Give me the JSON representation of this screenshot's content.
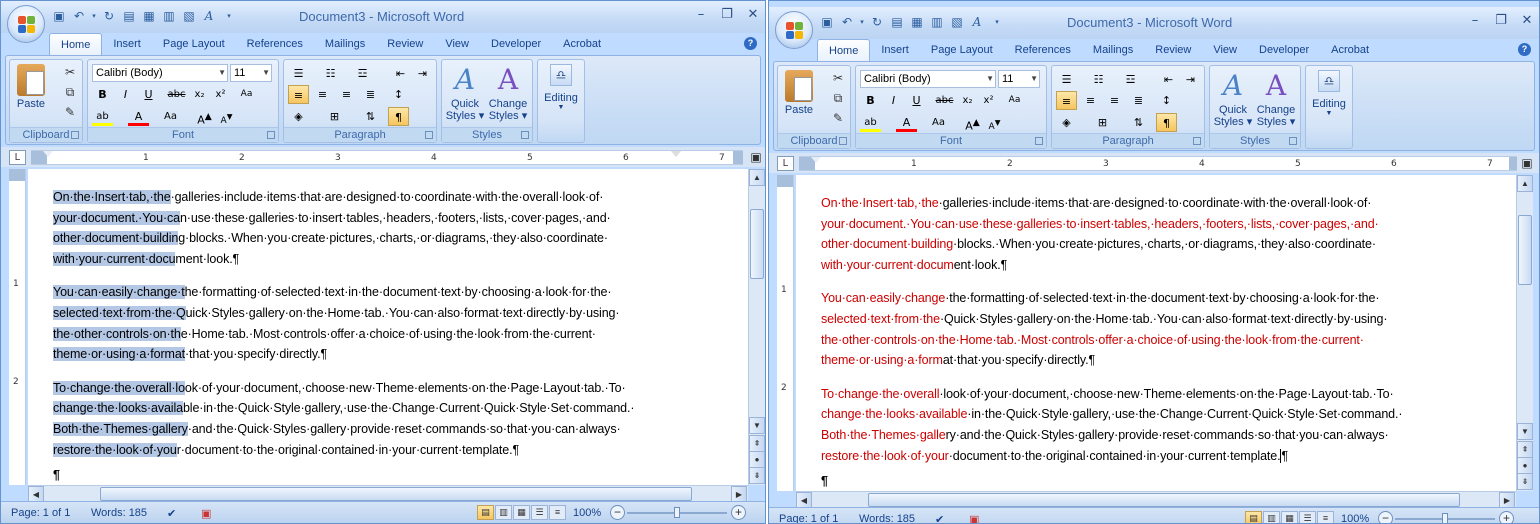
{
  "app": {
    "window_title": "Document3 - Microsoft Word",
    "tabs": [
      "Home",
      "Insert",
      "Page Layout",
      "References",
      "Mailings",
      "Review",
      "View",
      "Developer",
      "Acrobat"
    ]
  },
  "ribbon": {
    "clipboard": {
      "paste": "Paste",
      "label": "Clipboard"
    },
    "font": {
      "name": "Calibri (Body)",
      "size": "11",
      "label": "Font"
    },
    "paragraph": {
      "label": "Paragraph"
    },
    "styles": {
      "quick": "Quick",
      "quick2": "Styles ▾",
      "change": "Change",
      "change2": "Styles ▾",
      "label": "Styles"
    },
    "editing": {
      "label": "Editing"
    }
  },
  "ruler": {
    "numbers": [
      "1",
      "2",
      "3",
      "4",
      "5",
      "6",
      "7"
    ],
    "vnumbers": [
      "1",
      "2"
    ]
  },
  "document": {
    "paragraphs": [
      {
        "left": {
          "lines": [
            {
              "sel": "On·the·Insert·tab,·the",
              "rest": "·galleries·include·items·that·are·designed·to·coordinate·with·the·overall·look·of·"
            },
            {
              "sel": "your·document.·You·ca",
              "rest": "n·use·these·galleries·to·insert·tables,·headers,·footers,·lists,·cover·pages,·and·"
            },
            {
              "sel": "other·document·buildin",
              "rest": "g·blocks.·When·you·create·pictures,·charts,·or·diagrams,·they·also·coordinate·"
            },
            {
              "sel": "with·your·current·docu",
              "rest": "ment·look.¶"
            }
          ]
        },
        "right": {
          "lines": [
            {
              "red": "On·the·Insert·tab,·the",
              "rest": "·galleries·include·items·that·are·designed·to·coordinate·with·the·overall·look·of·"
            },
            {
              "red": "your·document.·You·can·use·these·galleries·to·insert·tables,·headers,·footers,·lists,·cover·pages,·and·",
              "rest": ""
            },
            {
              "red": "other·document·building",
              "rest": "·blocks.·When·you·create·pictures,·charts,·or·diagrams,·they·also·coordinate·"
            },
            {
              "red": "with·your·current·docum",
              "rest": "ent·look.¶"
            }
          ]
        }
      },
      {
        "left": {
          "lines": [
            {
              "sel": "You·can·easily·change·t",
              "rest": "he·formatting·of·selected·text·in·the·document·text·by·choosing·a·look·for·the·"
            },
            {
              "sel": "selected·text·from·the·Q",
              "rest": "uick·Styles·gallery·on·the·Home·tab.·You·can·also·format·text·directly·by·using·"
            },
            {
              "sel": "the·other·controls·on·th",
              "rest": "e·Home·tab.·Most·controls·offer·a·choice·of·using·the·look·from·the·current·"
            },
            {
              "sel": "theme·or·using·a·format",
              "rest": "·that·you·specify·directly.¶"
            }
          ]
        },
        "right": {
          "lines": [
            {
              "red": "You·can·easily·change",
              "rest": "·the·formatting·of·selected·text·in·the·document·text·by·choosing·a·look·for·the·"
            },
            {
              "red": "selected·text·from·the",
              "rest": "·Quick·Styles·gallery·on·the·Home·tab.·You·can·also·format·text·directly·by·using·"
            },
            {
              "red": "the·other·controls·on·the·Home·tab.·Most·controls·offer·a·choice·of·using·the·look·from·the·current·",
              "rest": ""
            },
            {
              "red": "theme·or·using·a·form",
              "rest": "at·that·you·specify·directly.¶"
            }
          ]
        }
      },
      {
        "left": {
          "lines": [
            {
              "sel": "To·change·the·overall·lo",
              "rest": "ok·of·your·document,·choose·new·Theme·elements·on·the·Page·Layout·tab.·To·"
            },
            {
              "sel": "change·the·looks·availa",
              "rest": "ble·in·the·Quick·Style·gallery,·use·the·Change·Current·Quick·Style·Set·command.·"
            },
            {
              "sel": "Both·the·Themes·gallery",
              "rest": "·and·the·Quick·Styles·gallery·provide·reset·commands·so·that·you·can·always·"
            },
            {
              "sel": "restore·the·look·of·you",
              "rest": "r·document·to·the·original·contained·in·your·current·template.¶"
            }
          ]
        },
        "right": {
          "lines": [
            {
              "red": "To·change·the·overall",
              "rest": "·look·of·your·document,·choose·new·Theme·elements·on·the·Page·Layout·tab.·To·"
            },
            {
              "red": "change·the·looks·available",
              "rest": "·in·the·Quick·Style·gallery,·use·the·Change·Current·Quick·Style·Set·command.·"
            },
            {
              "red": "Both·the·Themes·galle",
              "rest": "ry·and·the·Quick·Styles·gallery·provide·reset·commands·so·that·you·can·always·"
            },
            {
              "red": "restore·the·look·of·your",
              "rest": "·document·to·the·original·contained·in·your·current·template.",
              "caret": true,
              "tail": "¶"
            }
          ]
        }
      }
    ],
    "last_mark": "¶"
  },
  "status": {
    "page": "Page: 1 of 1",
    "words": "Words: 185",
    "zoom": "100%"
  },
  "colors": {
    "selection": "#b4c8e6",
    "red_text": "#cc0000",
    "ribbon_bg": "#bfdbff"
  }
}
